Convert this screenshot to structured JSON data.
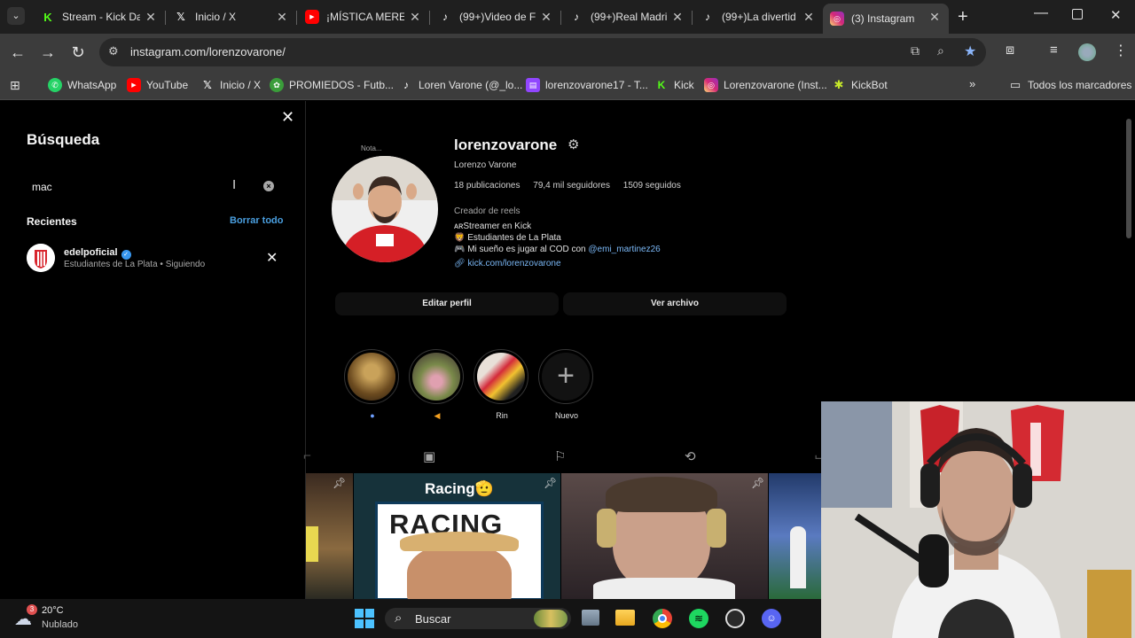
{
  "tabs": [
    {
      "label": "Stream - Kick Da",
      "icon": "kick-icon",
      "color": "#53fc18"
    },
    {
      "label": "Inicio / X",
      "icon": "x-icon",
      "color": "#ffffff"
    },
    {
      "label": "¡MÍSTICA MERE",
      "icon": "youtube-icon",
      "color": "#ff0000"
    },
    {
      "label": "(99+)Video de F",
      "icon": "tiktok-icon",
      "color": "#ffffff"
    },
    {
      "label": "(99+)Real Madri",
      "icon": "tiktok-icon",
      "color": "#ffffff"
    },
    {
      "label": "(99+)La divertid",
      "icon": "tiktok-icon",
      "color": "#ffffff"
    },
    {
      "label": "(3) Instagram",
      "icon": "instagram-icon",
      "color": "#e1306c"
    }
  ],
  "address": {
    "url": "instagram.com/lorenzovarone/"
  },
  "bookmarks": [
    {
      "label": "WhatsApp",
      "icon": "whatsapp-icon"
    },
    {
      "label": "YouTube",
      "icon": "youtube-icon"
    },
    {
      "label": "Inicio / X",
      "icon": "x-icon"
    },
    {
      "label": "PROMIEDOS - Futb...",
      "icon": "promiedos-icon"
    },
    {
      "label": "Loren Varone (@_lo...",
      "icon": "tiktok-icon"
    },
    {
      "label": "lorenzovarone17 - T...",
      "icon": "twitch-icon"
    },
    {
      "label": "Kick",
      "icon": "kick-icon"
    },
    {
      "label": "Lorenzovarone (Inst...",
      "icon": "instagram-icon"
    },
    {
      "label": "KickBot",
      "icon": "kickbot-icon"
    }
  ],
  "bookmarks_all": "Todos los marcadores",
  "search": {
    "title": "Búsqueda",
    "value": "mac",
    "recent_label": "Recientes",
    "clear_all": "Borrar todo",
    "recent": {
      "name": "edelpoficial",
      "sub": "Estudiantes de La Plata • Siguiendo"
    }
  },
  "profile": {
    "note": "Nota...",
    "username": "lorenzovarone",
    "full_name": "Lorenzo Varone",
    "posts": "18 publicaciones",
    "followers": "79,4 mil seguidores",
    "following": "1509 seguidos",
    "category": "Creador de reels",
    "bio1": "ᴀʀStreamer en Kick",
    "bio2": "🦁 Estudiantes de La Plata",
    "bio3_text": "🎮 Mi sueño es jugar al COD con ",
    "bio3_mention": "@emi_martinez26",
    "link": "kick.com/lorenzovarone",
    "edit_button": "Editar perfil",
    "archive_button": "Ver archivo",
    "highlights": [
      {
        "label": ""
      },
      {
        "label": ""
      },
      {
        "label": "Rin"
      },
      {
        "label": "Nuevo"
      }
    ],
    "grid_text": "Racing🫡",
    "grid_text2": "RACING"
  },
  "taskbar": {
    "temp": "20°C",
    "weather": "Nublado",
    "badge": "3",
    "search_placeholder": "Buscar"
  },
  "colors": {
    "link": "#4a9fe0",
    "verified": "#3897f0",
    "accent_kick": "#53fc18"
  }
}
